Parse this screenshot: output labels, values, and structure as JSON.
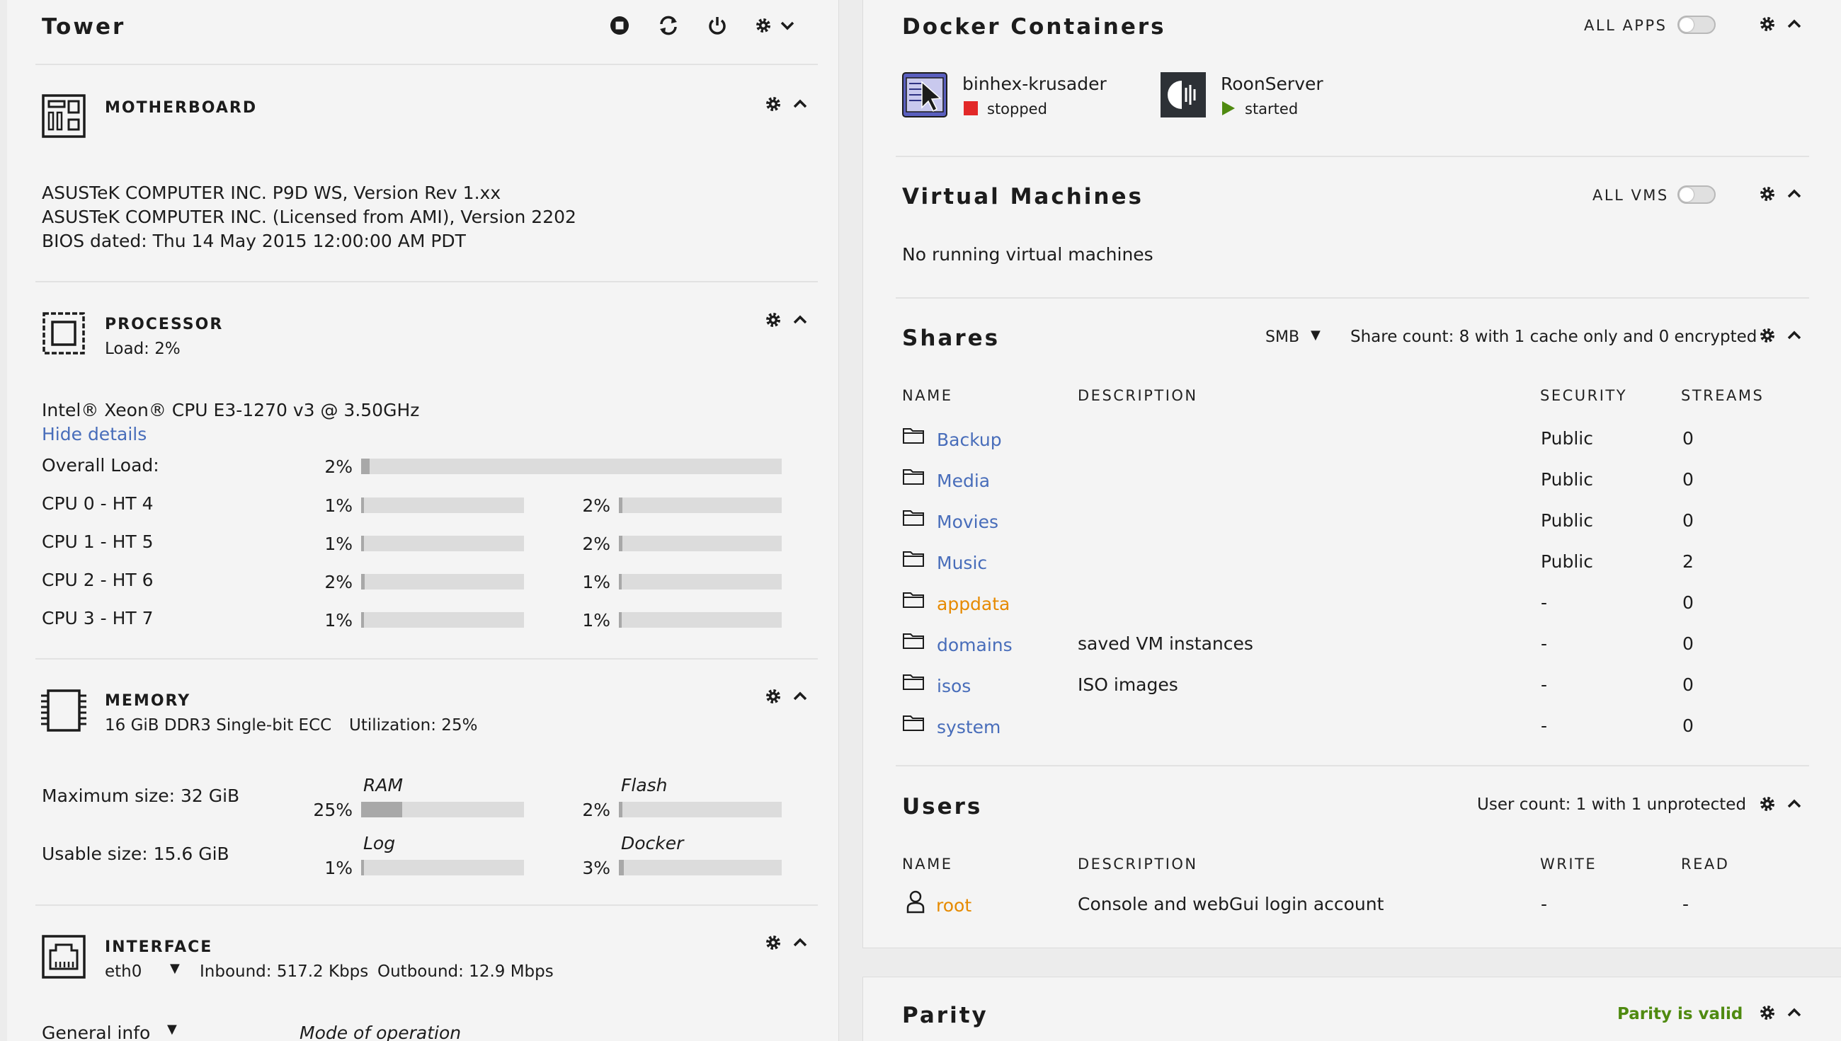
{
  "tower": {
    "title": "Tower",
    "motherboard": {
      "heading": "MOTHERBOARD",
      "lines": [
        "ASUSTeK COMPUTER INC. P9D WS, Version Rev 1.xx",
        "ASUSTeK COMPUTER INC. (Licensed from AMI), Version 2202",
        "BIOS dated: Thu 14 May 2015 12:00:00 AM PDT"
      ]
    },
    "processor": {
      "heading": "PROCESSOR",
      "load": "Load: 2%",
      "model": "Intel® Xeon® CPU E3-1270 v3 @ 3.50GHz",
      "hide_details": "Hide details",
      "overall_label": "Overall Load:",
      "overall_pct": "2%",
      "overall_value": 2,
      "cpus": [
        {
          "label": "CPU 0 - HT 4",
          "a_pct": "1%",
          "a_value": 1,
          "b_pct": "2%",
          "b_value": 2
        },
        {
          "label": "CPU 1 - HT 5",
          "a_pct": "1%",
          "a_value": 1,
          "b_pct": "2%",
          "b_value": 2
        },
        {
          "label": "CPU 2 - HT 6",
          "a_pct": "2%",
          "a_value": 2,
          "b_pct": "1%",
          "b_value": 1
        },
        {
          "label": "CPU 3 - HT 7",
          "a_pct": "1%",
          "a_value": 1,
          "b_pct": "1%",
          "b_value": 1
        }
      ]
    },
    "memory": {
      "heading": "MEMORY",
      "desc": "16 GiB DDR3 Single-bit ECC",
      "utilization": "Utilization: 25%",
      "max_size": "Maximum size: 32 GiB",
      "usable_size": "Usable size: 15.6 GiB",
      "ram": {
        "label": "RAM",
        "pct": "25%",
        "value": 25
      },
      "flash": {
        "label": "Flash",
        "pct": "2%",
        "value": 2
      },
      "log": {
        "label": "Log",
        "pct": "1%",
        "value": 1
      },
      "docker": {
        "label": "Docker",
        "pct": "3%",
        "value": 3
      }
    },
    "interface": {
      "heading": "INTERFACE",
      "nic": "eth0",
      "inbound": "Inbound: 517.2 Kbps",
      "outbound": "Outbound: 12.9 Mbps",
      "general_info": "General info",
      "mode": "Mode of operation"
    }
  },
  "docker": {
    "title": "Docker Containers",
    "all_apps": "ALL APPS",
    "containers": [
      {
        "name": "binhex-krusader",
        "status": "stopped",
        "status_color": "#e22828"
      },
      {
        "name": "RoonServer",
        "status": "started",
        "status_color": "#4f8a10"
      }
    ]
  },
  "vms": {
    "title": "Virtual Machines",
    "all_vms": "ALL VMS",
    "empty": "No running virtual machines"
  },
  "shares": {
    "title": "Shares",
    "protocol": "SMB",
    "summary": "Share count: 8 with 1 cache only and 0 encrypted",
    "columns": [
      "NAME",
      "DESCRIPTION",
      "SECURITY",
      "STREAMS"
    ],
    "rows": [
      {
        "name": "Backup",
        "desc": "",
        "security": "Public",
        "streams": "0"
      },
      {
        "name": "Media",
        "desc": "",
        "security": "Public",
        "streams": "0"
      },
      {
        "name": "Movies",
        "desc": "",
        "security": "Public",
        "streams": "0"
      },
      {
        "name": "Music",
        "desc": "",
        "security": "Public",
        "streams": "2"
      },
      {
        "name": "appdata",
        "desc": "",
        "security": "-",
        "streams": "0"
      },
      {
        "name": "domains",
        "desc": "saved VM instances",
        "security": "-",
        "streams": "0"
      },
      {
        "name": "isos",
        "desc": "ISO images",
        "security": "-",
        "streams": "0"
      },
      {
        "name": "system",
        "desc": "",
        "security": "-",
        "streams": "0"
      }
    ]
  },
  "users": {
    "title": "Users",
    "summary": "User count: 1 with 1 unprotected",
    "columns": [
      "NAME",
      "DESCRIPTION",
      "WRITE",
      "READ"
    ],
    "rows": [
      {
        "name": "root",
        "desc": "Console and webGui login account",
        "write": "-",
        "read": "-"
      }
    ]
  },
  "parity": {
    "title": "Parity",
    "status": "Parity is valid",
    "status_color": "#4f8a10"
  }
}
